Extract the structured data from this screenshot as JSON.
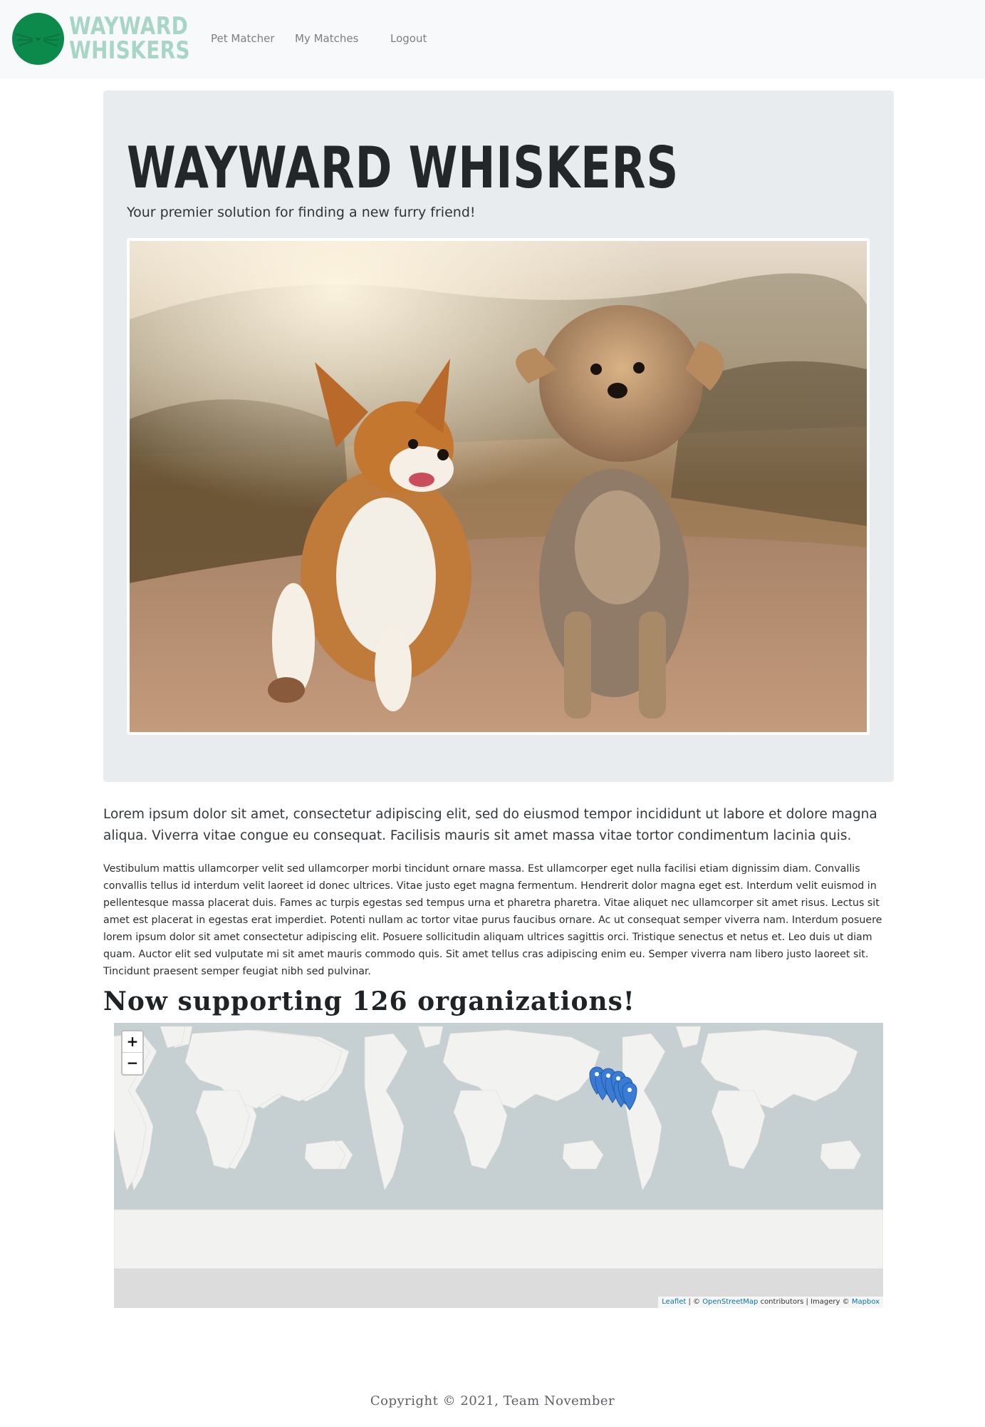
{
  "navbar": {
    "logo_text_line1": "WAYWARD",
    "logo_text_line2": "WHISKERS",
    "links": [
      {
        "label": "Pet Matcher"
      },
      {
        "label": "My Matches"
      },
      {
        "label": "Logout"
      }
    ]
  },
  "hero": {
    "title": "WAYWARD WHISKERS",
    "subtitle": "Your premier solution for finding a new furry friend!"
  },
  "content": {
    "lead": "Lorem ipsum dolor sit amet, consectetur adipiscing elit, sed do eiusmod tempor incididunt ut labore et dolore magna aliqua. Viverra vitae congue eu consequat. Facilisis mauris sit amet massa vitae tortor condimentum lacinia quis.",
    "paragraph": "Vestibulum mattis ullamcorper velit sed ullamcorper morbi tincidunt ornare massa. Est ullamcorper eget nulla facilisi etiam dignissim diam. Convallis convallis tellus id interdum velit laoreet id donec ultrices. Vitae justo eget magna fermentum. Hendrerit dolor magna eget est. Interdum velit euismod in pellentesque massa placerat duis. Fames ac turpis egestas sed tempus urna et pharetra pharetra. Vitae aliquet nec ullamcorper sit amet risus. Lectus sit amet est placerat in egestas erat imperdiet. Potenti nullam ac tortor vitae purus faucibus ornare. Ac ut consequat semper viverra nam. Interdum posuere lorem ipsum dolor sit amet consectetur adipiscing elit. Posuere sollicitudin aliquam ultrices sagittis orci. Tristique senectus et netus et. Leo duis ut diam quam. Auctor elit sed vulputate mi sit amet mauris commodo quis. Sit amet tellus cras adipiscing enim eu. Semper viverra nam libero justo laoreet sit. Tincidunt praesent semper feugiat nibh sed pulvinar.",
    "section_title": "Now supporting 126 organizations!"
  },
  "map": {
    "zoom_in": "+",
    "zoom_out": "−",
    "attribution": {
      "leaflet": "Leaflet",
      "sep1": " | © ",
      "osm": "OpenStreetMap",
      "middle": " contributors | Imagery © ",
      "mapbox": "Mapbox"
    },
    "marker_color": "#3a7bd5",
    "ocean_color": "#c6cfd2",
    "land_color": "#f2f2f0"
  },
  "footer": {
    "copyright": "Copyright © 2021, Team November"
  },
  "colors": {
    "navbar_bg": "#f8f9fa",
    "logo_green": "#0b8a4b",
    "logo_text": "#a7d6c6",
    "jumbotron_bg": "#e9ecef"
  }
}
